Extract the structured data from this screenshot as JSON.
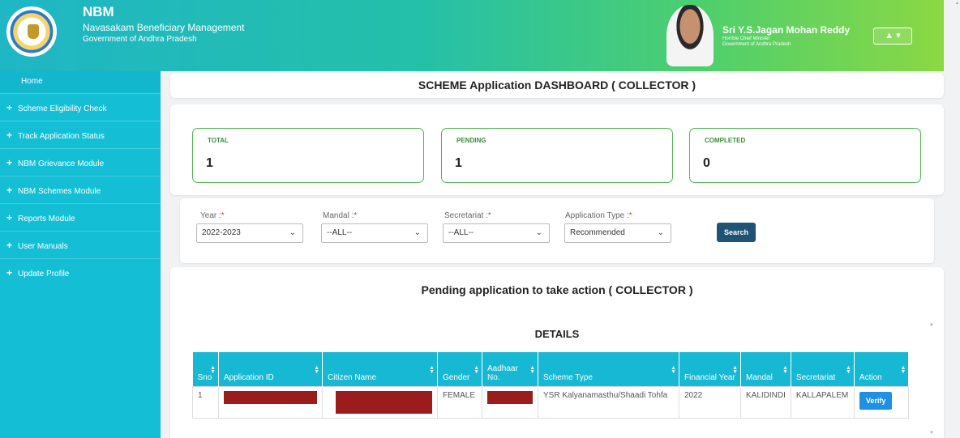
{
  "header": {
    "app_name": "NBM",
    "app_full_name": "Navasakam Beneficiary Management",
    "government": "Government of Andhra Pradesh",
    "cm_name": "Sri Y.S.Jagan Mohan Reddy",
    "cm_role": "Hon'ble Chief Minister",
    "cm_government": "Government of Andhra Pradesh",
    "user_menu_label": "▲ ▾"
  },
  "sidebar": {
    "home_label": "Home",
    "items": [
      {
        "label": "Scheme Eligibility Check"
      },
      {
        "label": "Track Application Status"
      },
      {
        "label": "NBM Grievance Module"
      },
      {
        "label": "NBM Schemes Module"
      },
      {
        "label": "Reports Module"
      },
      {
        "label": "User Manuals"
      },
      {
        "label": "Update Profile"
      }
    ]
  },
  "dashboard": {
    "title": "SCHEME Application DASHBOARD ( COLLECTOR )",
    "stats": [
      {
        "label": "TOTAL",
        "value": "1"
      },
      {
        "label": "PENDING",
        "value": "1"
      },
      {
        "label": "COMPLETED",
        "value": "0"
      }
    ]
  },
  "filters": {
    "year": {
      "label": "Year :",
      "required": "*",
      "value": "2022-2023"
    },
    "mandal": {
      "label": "Mandal :",
      "required": "*",
      "value": "--ALL--"
    },
    "secretariat": {
      "label": "Secretariat :",
      "required": "*",
      "value": "--ALL--"
    },
    "application_type": {
      "label": "Application Type :",
      "required": "*",
      "value": "Recommended"
    },
    "search_label": "Search"
  },
  "pending": {
    "title": "Pending application to take action ( COLLECTOR )",
    "details_title": "DETAILS",
    "columns": [
      "Sno",
      "Application ID",
      "Citizen Name",
      "Gender",
      "Aadhaar No.",
      "Scheme Type",
      "Financial Year",
      "Mandal",
      "Secretariat",
      "Action"
    ],
    "rows": [
      {
        "sno": "1",
        "gender": "FEMALE",
        "scheme_type": "YSR Kalyanamasthu/Shaadi Tohfa",
        "financial_year": "2022",
        "mandal": "KALIDINDI",
        "secretariat": "KALLAPALEM",
        "action_label": "Verify"
      }
    ]
  },
  "colors": {
    "sidebar": "#14bfd6",
    "table_header": "#17b8d3",
    "stat_border": "#4cb54e",
    "search_button": "#1e5376",
    "verify_button": "#1e90e5",
    "redaction": "#9b1c1c"
  }
}
